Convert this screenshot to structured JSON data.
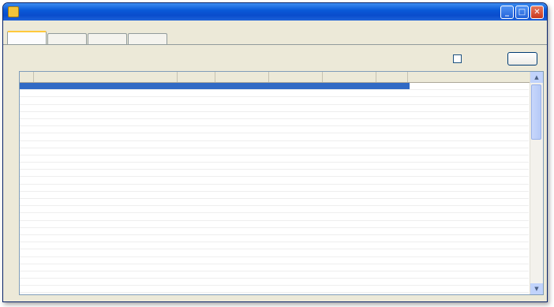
{
  "window": {
    "title": ""
  },
  "menubar": {
    "items": [
      "",
      ""
    ]
  },
  "tabs": [
    "",
    "",
    "",
    ""
  ],
  "active_tab": 0,
  "instruction": "",
  "checkbox": {
    "label": "",
    "checked": false
  },
  "action_button": {
    "label": ""
  },
  "grid": {
    "headers": [
      "",
      "",
      "",
      "",
      "",
      "",
      ""
    ],
    "row_count": 29,
    "selected_row": 0,
    "selection_color": "#316ac5"
  },
  "colors": {
    "title_bar": "#0a4ccc",
    "window_bg": "#ece9d8",
    "selection": "#316ac5"
  }
}
